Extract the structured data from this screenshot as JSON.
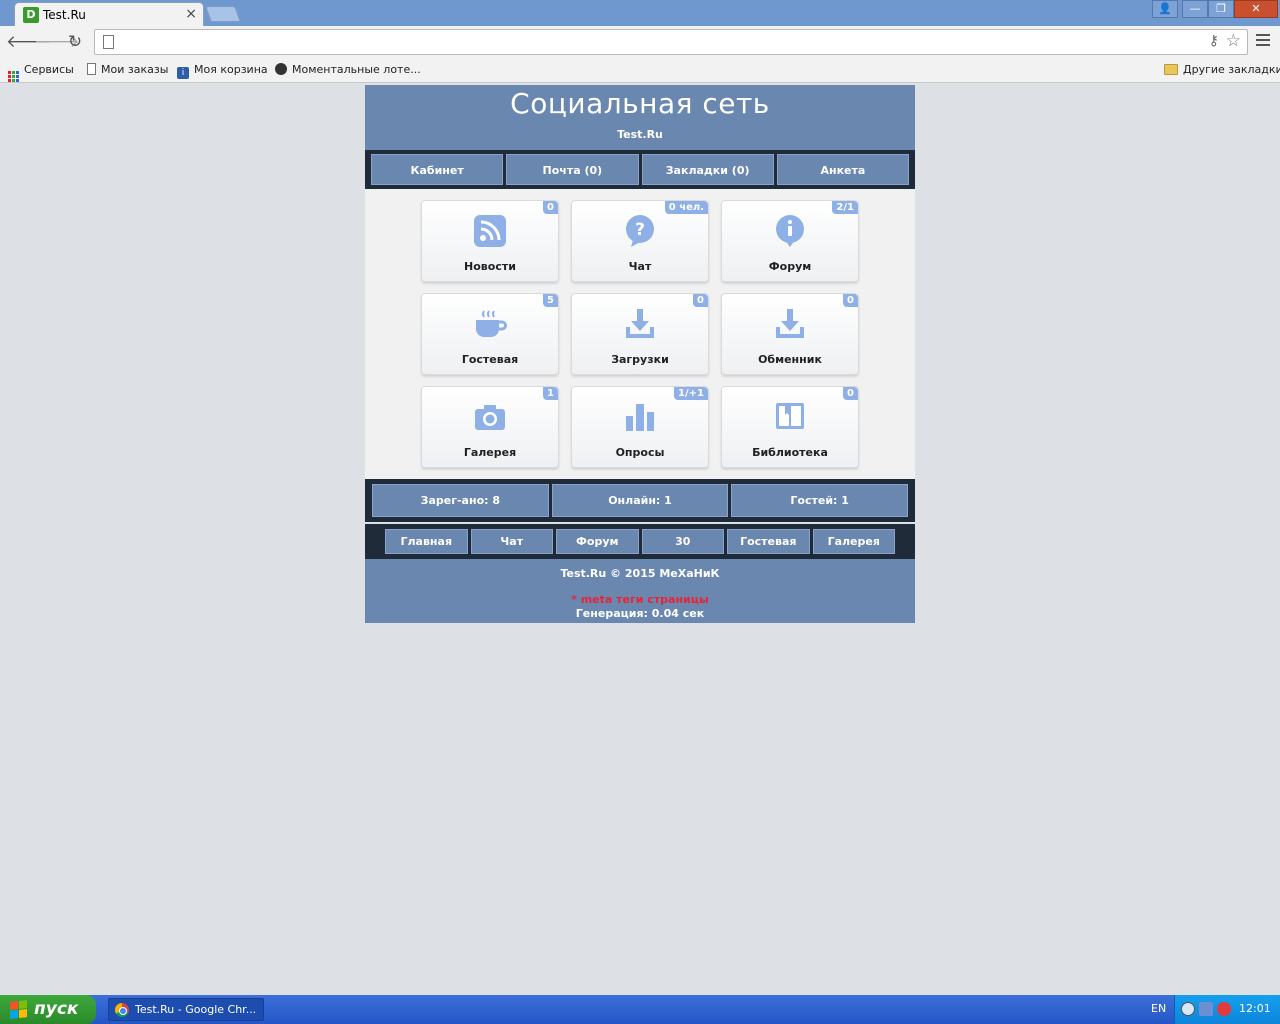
{
  "browser": {
    "tab_title": "Test.Ru",
    "tab_favicon": "D",
    "bookmarks": [
      "Сервисы",
      "Мои заказы",
      "Моя корзина",
      "Моментальные лоте..."
    ],
    "other_bookmarks": "Другие закладки"
  },
  "site": {
    "title": "Социальная сеть",
    "subtitle": "Test.Ru",
    "top_nav": [
      "Кабинет",
      "Почта (0)",
      "Закладки (0)",
      "Анкета"
    ],
    "tiles": [
      {
        "label": "Новости",
        "badge": "0",
        "icon": "rss-icon"
      },
      {
        "label": "Чат",
        "badge": "0 чел.",
        "icon": "question-bubble-icon"
      },
      {
        "label": "Форум",
        "badge": "2/1",
        "icon": "info-bubble-icon"
      },
      {
        "label": "Гостевая",
        "badge": "5",
        "icon": "coffee-cup-icon"
      },
      {
        "label": "Загрузки",
        "badge": "0",
        "icon": "download-icon"
      },
      {
        "label": "Обменник",
        "badge": "0",
        "icon": "download-icon"
      },
      {
        "label": "Галерея",
        "badge": "1",
        "icon": "camera-icon"
      },
      {
        "label": "Опросы",
        "badge": "1/+1",
        "icon": "bar-chart-icon"
      },
      {
        "label": "Библиотека",
        "badge": "0",
        "icon": "book-icon"
      }
    ],
    "stats": [
      "Зарег-ано: 8",
      "Онлайн: 1",
      "Гостей: 1"
    ],
    "bottom_nav": [
      "Главная",
      "Чат",
      "Форум",
      "30",
      "Гостевая",
      "Галерея"
    ],
    "footer": {
      "copyright": "Test.Ru © 2015 МеХаНиК",
      "meta": "* meta теги страницы",
      "generation": "Генерация: 0.04 сек"
    },
    "colors": {
      "accent": "#6a87b0",
      "dark": "#1f2b38",
      "icon": "#8fb0e6",
      "meta": "#e8243a"
    }
  },
  "taskbar": {
    "start": "пуск",
    "task": "Test.Ru - Google Chr...",
    "lang": "EN",
    "clock": "12:01"
  }
}
